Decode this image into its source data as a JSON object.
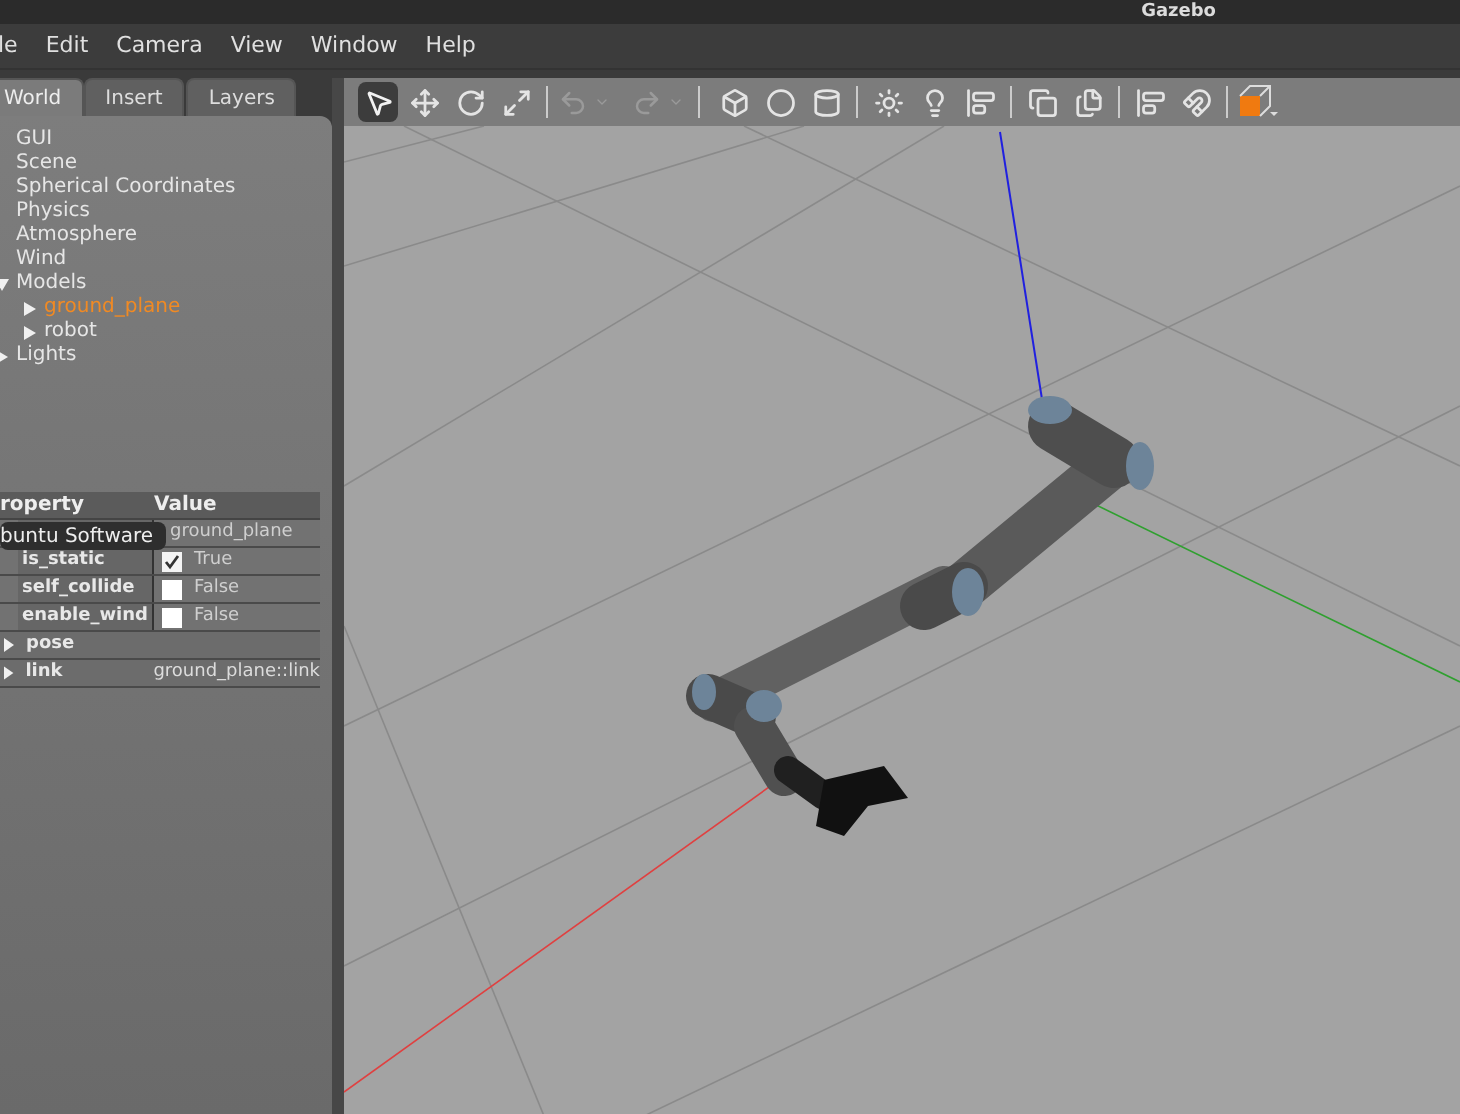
{
  "window": {
    "title": "Gazebo"
  },
  "menu": [
    "le",
    "Edit",
    "Camera",
    "View",
    "Window",
    "Help"
  ],
  "tabs": [
    {
      "label": "World",
      "selected": true
    },
    {
      "label": "Insert",
      "selected": false
    },
    {
      "label": "Layers",
      "selected": false
    }
  ],
  "tree": [
    {
      "label": "GUI",
      "selected": false
    },
    {
      "label": "Scene",
      "selected": false
    },
    {
      "label": "Spherical Coordinates",
      "selected": false
    },
    {
      "label": "Physics",
      "selected": false
    },
    {
      "label": "Atmosphere",
      "selected": false
    },
    {
      "label": "Wind",
      "selected": false
    },
    {
      "label": "Models",
      "selected": false,
      "expanded": true,
      "children": [
        {
          "label": "ground_plane",
          "selected": true,
          "expanded": false
        },
        {
          "label": "robot",
          "selected": false,
          "expanded": false
        }
      ]
    },
    {
      "label": "Lights",
      "selected": false,
      "expanded": false
    }
  ],
  "properties": {
    "columns": [
      "roperty",
      "Value"
    ],
    "rows": [
      {
        "kind": "text",
        "name": "",
        "value": "ground_plane"
      },
      {
        "kind": "checkbox",
        "name": "is_static",
        "checked": true,
        "value": "True"
      },
      {
        "kind": "checkbox",
        "name": "self_collide",
        "checked": false,
        "value": "False"
      },
      {
        "kind": "checkbox",
        "name": "enable_wind",
        "checked": false,
        "value": "False"
      },
      {
        "kind": "group",
        "name": "pose",
        "value": ""
      },
      {
        "kind": "group",
        "name": "link",
        "value": "ground_plane::link"
      }
    ]
  },
  "tooltip": "buntu Software"
}
